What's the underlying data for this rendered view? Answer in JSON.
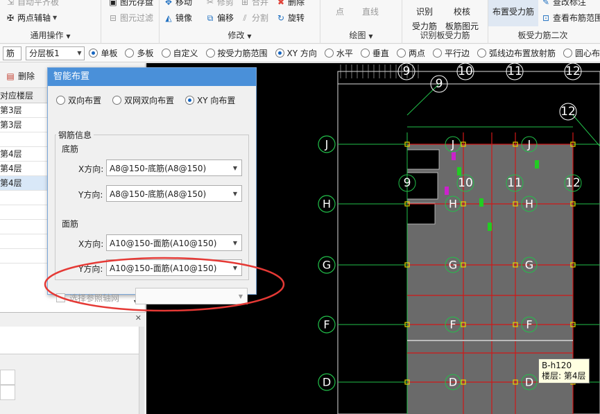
{
  "ribbon": {
    "tools_left": [
      {
        "label": "自动平齐板",
        "dim": true
      },
      {
        "label": "两点辅轴",
        "dim": false
      },
      {
        "label": "图元存盘",
        "dim": false
      },
      {
        "label": "图元过滤",
        "dim": true
      }
    ],
    "group_general": "通用操作",
    "tools_modify": [
      {
        "label": "移动"
      },
      {
        "label": "修剪"
      },
      {
        "label": "删除"
      },
      {
        "label": "镜像"
      },
      {
        "label": "偏移"
      },
      {
        "label": "分割"
      },
      {
        "label": "旋转"
      }
    ],
    "group_modify": "修改",
    "draw_tools": [
      {
        "label": "点"
      },
      {
        "label": "直线"
      }
    ],
    "group_draw": "绘图",
    "identify_rebar": [
      "识别",
      "受力筋"
    ],
    "check_rebar": [
      "校核",
      "板筋图元"
    ],
    "group_identify": "识别板受力筋",
    "layout_rebar": "布置受力筋",
    "modify_label": "查改标注",
    "view_range": "查看布筋范围",
    "group_rebar2": "板受力筋二次"
  },
  "toolbar": {
    "combo1": "筋",
    "combo2": "分层板1",
    "options": [
      {
        "label": "单板",
        "on": true
      },
      {
        "label": "多板",
        "on": false
      },
      {
        "label": "自定义",
        "on": false
      },
      {
        "label": "按受力筋范围",
        "on": false
      },
      {
        "label": "XY 方向",
        "on": true
      },
      {
        "label": "水平",
        "on": false
      },
      {
        "label": "垂直",
        "on": false
      },
      {
        "label": "两点",
        "on": false
      },
      {
        "label": "平行边",
        "on": false
      },
      {
        "label": "弧线边布置放射筋",
        "on": false
      },
      {
        "label": "圆心布",
        "on": false
      }
    ]
  },
  "left_panel": {
    "delete_label": "删除",
    "column_header": "对应楼层",
    "rows": [
      {
        "label": "第3层",
        "selected": false
      },
      {
        "label": "第3层",
        "selected": false
      },
      {
        "label": "",
        "selected": false
      },
      {
        "label": "第4层",
        "selected": false
      },
      {
        "label": "第4层",
        "selected": false
      },
      {
        "label": "第4层",
        "selected": true
      }
    ]
  },
  "dialog": {
    "title": "智能布置",
    "modes": [
      {
        "label": "双向布置",
        "on": false
      },
      {
        "label": "双网双向布置",
        "on": false
      },
      {
        "label": "XY 向布置",
        "on": true
      }
    ],
    "group_title": "钢筋信息",
    "bottom_title": "底筋",
    "bottom_x_label": "X方向:",
    "bottom_x_value": "A8@150-底筋(A8@150)",
    "bottom_y_label": "Y方向:",
    "bottom_y_value": "A8@150-底筋(A8@150)",
    "top_title": "面筋",
    "top_x_label": "X方向:",
    "top_x_value": "A10@150-面筋(A10@150)",
    "top_y_label": "Y方向:",
    "top_y_value": "A10@150-面筋(A10@150)",
    "ref_axis_label": "选择参照轴网",
    "ref_axis_value": ""
  },
  "canvas": {
    "top_axes": [
      "9",
      "10",
      "11",
      "12"
    ],
    "slant_axes": [
      "9",
      "12"
    ],
    "left_axes": [
      "J",
      "H",
      "G",
      "F",
      "D"
    ],
    "inner_row_labels": [
      "J",
      "H",
      "G",
      "F",
      "D"
    ],
    "inner_col_labels": [
      "9",
      "10",
      "11",
      "12"
    ]
  },
  "tooltip": {
    "name": "B-h120",
    "floor": "楼层: 第4层"
  },
  "colors": {
    "ribbon_bg": "#f7f7f7",
    "dialog_title": "#4a90d9",
    "canvas_bg": "#000000",
    "axis_green": "#22c04a",
    "slab_gray": "#6a6a6a",
    "rebar_red": "#d01818",
    "annotation_red": "#e53935"
  }
}
